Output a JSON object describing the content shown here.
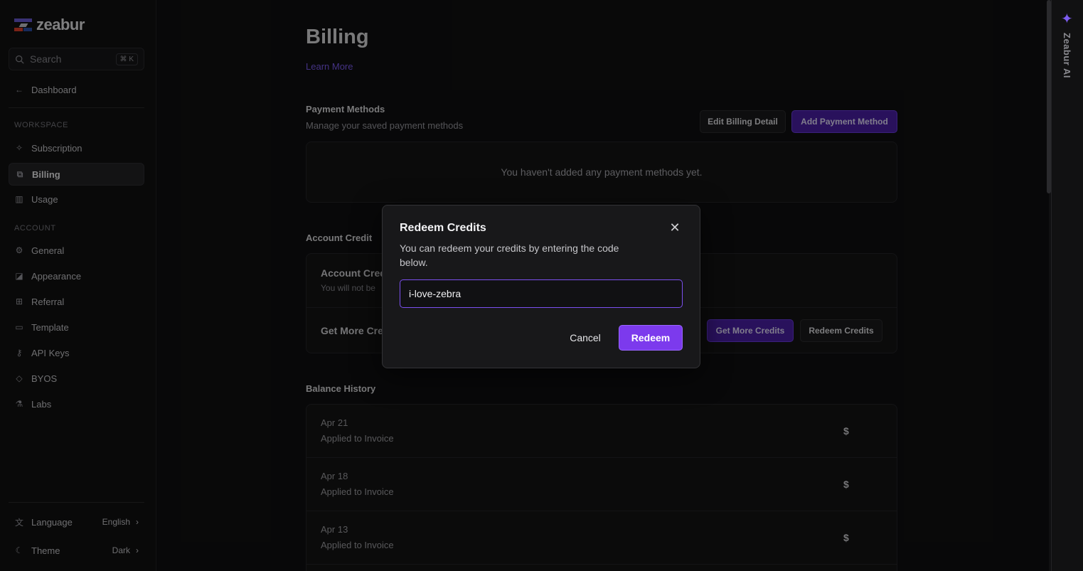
{
  "brand": {
    "name": "zeabur"
  },
  "sidebar": {
    "search": {
      "label": "Search",
      "shortcut": "⌘ K"
    },
    "back": "Dashboard",
    "workspace_label": "WORKSPACE",
    "workspace_items": [
      {
        "label": "Subscription",
        "icon": "sparkle-icon"
      },
      {
        "label": "Billing",
        "icon": "billing-icon",
        "active": true
      },
      {
        "label": "Usage",
        "icon": "chart-icon"
      }
    ],
    "account_label": "ACCOUNT",
    "account_items": [
      {
        "label": "General",
        "icon": "gear-icon"
      },
      {
        "label": "Appearance",
        "icon": "palette-icon"
      },
      {
        "label": "Referral",
        "icon": "gift-icon"
      },
      {
        "label": "Template",
        "icon": "folder-icon"
      },
      {
        "label": "API Keys",
        "icon": "key-icon"
      },
      {
        "label": "BYOS",
        "icon": "server-icon"
      },
      {
        "label": "Labs",
        "icon": "flask-icon"
      }
    ],
    "language": {
      "label": "Language",
      "value": "English"
    },
    "theme": {
      "label": "Theme",
      "value": "Dark"
    }
  },
  "main": {
    "title": "Billing",
    "learn_more": "Learn More",
    "payment": {
      "title": "Payment Methods",
      "subtitle": "Manage your saved payment methods",
      "edit_button": "Edit Billing Detail",
      "add_button": "Add Payment Method",
      "empty": "You haven't added any payment methods yet."
    },
    "credit": {
      "section_title": "Account Credit",
      "row1_title": "Account Cred",
      "row1_sub": "You will not be",
      "row2_title": "Get More Cre",
      "get_more_button": "Get More Credits",
      "redeem_button": "Redeem Credits"
    },
    "history": {
      "title": "Balance History",
      "rows": [
        {
          "date": "Apr 21",
          "desc": "Applied to Invoice",
          "amount": "$"
        },
        {
          "date": "Apr 18",
          "desc": "Applied to Invoice",
          "amount": "$"
        },
        {
          "date": "Apr 13",
          "desc": "Applied to Invoice",
          "amount": "$"
        }
      ]
    }
  },
  "rail": {
    "label": "Zeabur AI"
  },
  "modal": {
    "title": "Redeem Credits",
    "description": "You can redeem your credits by entering the code below.",
    "input_value": "i-love-zebra",
    "cancel": "Cancel",
    "submit": "Redeem"
  },
  "colors": {
    "accent": "#7c3aed",
    "background": "#101011"
  }
}
